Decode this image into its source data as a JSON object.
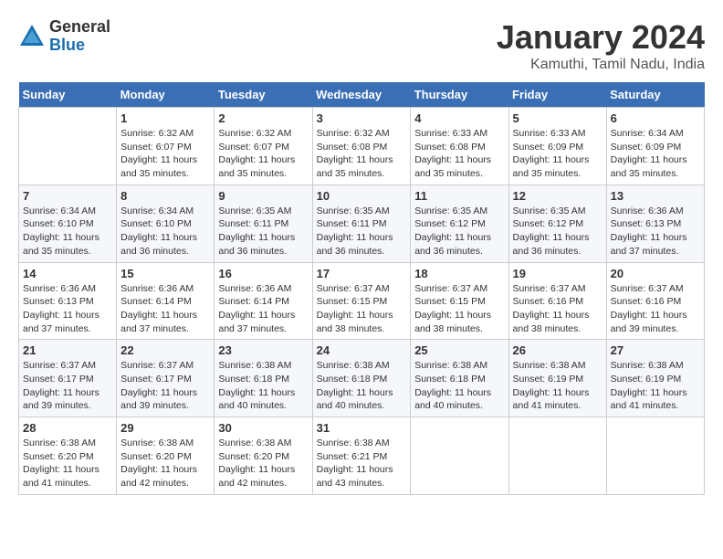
{
  "header": {
    "logo_general": "General",
    "logo_blue": "Blue",
    "month_title": "January 2024",
    "subtitle": "Kamuthi, Tamil Nadu, India"
  },
  "days_of_week": [
    "Sunday",
    "Monday",
    "Tuesday",
    "Wednesday",
    "Thursday",
    "Friday",
    "Saturday"
  ],
  "weeks": [
    {
      "days": [
        {
          "num": "",
          "info": ""
        },
        {
          "num": "1",
          "info": "Sunrise: 6:32 AM\nSunset: 6:07 PM\nDaylight: 11 hours\nand 35 minutes."
        },
        {
          "num": "2",
          "info": "Sunrise: 6:32 AM\nSunset: 6:07 PM\nDaylight: 11 hours\nand 35 minutes."
        },
        {
          "num": "3",
          "info": "Sunrise: 6:32 AM\nSunset: 6:08 PM\nDaylight: 11 hours\nand 35 minutes."
        },
        {
          "num": "4",
          "info": "Sunrise: 6:33 AM\nSunset: 6:08 PM\nDaylight: 11 hours\nand 35 minutes."
        },
        {
          "num": "5",
          "info": "Sunrise: 6:33 AM\nSunset: 6:09 PM\nDaylight: 11 hours\nand 35 minutes."
        },
        {
          "num": "6",
          "info": "Sunrise: 6:34 AM\nSunset: 6:09 PM\nDaylight: 11 hours\nand 35 minutes."
        }
      ]
    },
    {
      "days": [
        {
          "num": "7",
          "info": "Sunrise: 6:34 AM\nSunset: 6:10 PM\nDaylight: 11 hours\nand 35 minutes."
        },
        {
          "num": "8",
          "info": "Sunrise: 6:34 AM\nSunset: 6:10 PM\nDaylight: 11 hours\nand 36 minutes."
        },
        {
          "num": "9",
          "info": "Sunrise: 6:35 AM\nSunset: 6:11 PM\nDaylight: 11 hours\nand 36 minutes."
        },
        {
          "num": "10",
          "info": "Sunrise: 6:35 AM\nSunset: 6:11 PM\nDaylight: 11 hours\nand 36 minutes."
        },
        {
          "num": "11",
          "info": "Sunrise: 6:35 AM\nSunset: 6:12 PM\nDaylight: 11 hours\nand 36 minutes."
        },
        {
          "num": "12",
          "info": "Sunrise: 6:35 AM\nSunset: 6:12 PM\nDaylight: 11 hours\nand 36 minutes."
        },
        {
          "num": "13",
          "info": "Sunrise: 6:36 AM\nSunset: 6:13 PM\nDaylight: 11 hours\nand 37 minutes."
        }
      ]
    },
    {
      "days": [
        {
          "num": "14",
          "info": "Sunrise: 6:36 AM\nSunset: 6:13 PM\nDaylight: 11 hours\nand 37 minutes."
        },
        {
          "num": "15",
          "info": "Sunrise: 6:36 AM\nSunset: 6:14 PM\nDaylight: 11 hours\nand 37 minutes."
        },
        {
          "num": "16",
          "info": "Sunrise: 6:36 AM\nSunset: 6:14 PM\nDaylight: 11 hours\nand 37 minutes."
        },
        {
          "num": "17",
          "info": "Sunrise: 6:37 AM\nSunset: 6:15 PM\nDaylight: 11 hours\nand 38 minutes."
        },
        {
          "num": "18",
          "info": "Sunrise: 6:37 AM\nSunset: 6:15 PM\nDaylight: 11 hours\nand 38 minutes."
        },
        {
          "num": "19",
          "info": "Sunrise: 6:37 AM\nSunset: 6:16 PM\nDaylight: 11 hours\nand 38 minutes."
        },
        {
          "num": "20",
          "info": "Sunrise: 6:37 AM\nSunset: 6:16 PM\nDaylight: 11 hours\nand 39 minutes."
        }
      ]
    },
    {
      "days": [
        {
          "num": "21",
          "info": "Sunrise: 6:37 AM\nSunset: 6:17 PM\nDaylight: 11 hours\nand 39 minutes."
        },
        {
          "num": "22",
          "info": "Sunrise: 6:37 AM\nSunset: 6:17 PM\nDaylight: 11 hours\nand 39 minutes."
        },
        {
          "num": "23",
          "info": "Sunrise: 6:38 AM\nSunset: 6:18 PM\nDaylight: 11 hours\nand 40 minutes."
        },
        {
          "num": "24",
          "info": "Sunrise: 6:38 AM\nSunset: 6:18 PM\nDaylight: 11 hours\nand 40 minutes."
        },
        {
          "num": "25",
          "info": "Sunrise: 6:38 AM\nSunset: 6:18 PM\nDaylight: 11 hours\nand 40 minutes."
        },
        {
          "num": "26",
          "info": "Sunrise: 6:38 AM\nSunset: 6:19 PM\nDaylight: 11 hours\nand 41 minutes."
        },
        {
          "num": "27",
          "info": "Sunrise: 6:38 AM\nSunset: 6:19 PM\nDaylight: 11 hours\nand 41 minutes."
        }
      ]
    },
    {
      "days": [
        {
          "num": "28",
          "info": "Sunrise: 6:38 AM\nSunset: 6:20 PM\nDaylight: 11 hours\nand 41 minutes."
        },
        {
          "num": "29",
          "info": "Sunrise: 6:38 AM\nSunset: 6:20 PM\nDaylight: 11 hours\nand 42 minutes."
        },
        {
          "num": "30",
          "info": "Sunrise: 6:38 AM\nSunset: 6:20 PM\nDaylight: 11 hours\nand 42 minutes."
        },
        {
          "num": "31",
          "info": "Sunrise: 6:38 AM\nSunset: 6:21 PM\nDaylight: 11 hours\nand 43 minutes."
        },
        {
          "num": "",
          "info": ""
        },
        {
          "num": "",
          "info": ""
        },
        {
          "num": "",
          "info": ""
        }
      ]
    }
  ]
}
